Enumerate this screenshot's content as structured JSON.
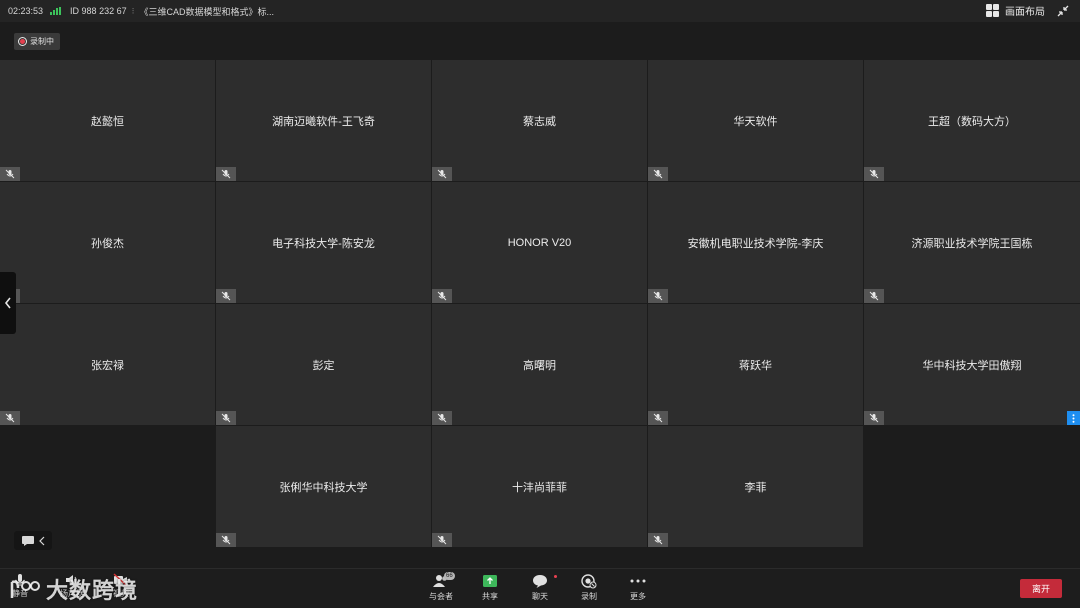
{
  "topbar": {
    "time": "02:23:53",
    "meeting_id": "ID 988 232 67",
    "meeting_title": "《三维CAD数据模型和格式》标...",
    "layout_label": "画面布局"
  },
  "recording_badge": "录制中",
  "participants": [
    "赵懿恒",
    "湖南迈曦软件-王飞奇",
    "蔡志威",
    "华天软件",
    "王超（数码大方）",
    "孙俊杰",
    "电子科技大学-陈安龙",
    "HONOR V20",
    "安徽机电职业技术学院-李庆",
    "济源职业技术学院王国栋",
    "张宏禄",
    "彭定",
    "高曙明",
    "蒋跃华",
    "华中科技大学田傲翔",
    "张俐华中科技大学",
    "十沣尚菲菲",
    "李菲"
  ],
  "bottombar": {
    "left": [
      {
        "label": "静音",
        "icon": "mic-icon"
      },
      {
        "label": "扬声器",
        "icon": "speaker-icon"
      },
      {
        "label": "视频",
        "icon": "video-off-icon"
      }
    ],
    "participants_label": "与会者",
    "participants_count": "66",
    "share_label": "共享",
    "chat_label": "聊天",
    "record_label": "录制",
    "more_label": "更多",
    "leave_label": "离开"
  },
  "watermark": "大数跨境"
}
